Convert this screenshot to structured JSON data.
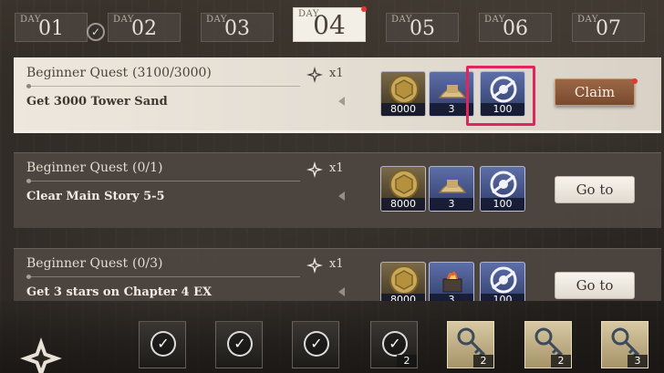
{
  "tabs": {
    "day_word": "DAY",
    "items": [
      {
        "num": "01",
        "completed": true
      },
      {
        "num": "02"
      },
      {
        "num": "03"
      },
      {
        "num": "04",
        "active": true,
        "notification": true
      },
      {
        "num": "05"
      },
      {
        "num": "06"
      },
      {
        "num": "07"
      }
    ]
  },
  "quests": [
    {
      "title": "Beginner Quest",
      "progress": "(3100/3000)",
      "multiplier": "x1",
      "description": "Get 3000 Tower Sand",
      "rewards": [
        "8000",
        "3",
        "100"
      ],
      "action": "Claim"
    },
    {
      "title": "Beginner Quest",
      "progress": "(0/1)",
      "multiplier": "x1",
      "description": "Clear Main Story 5-5",
      "rewards": [
        "8000",
        "3",
        "100"
      ],
      "action": "Go to"
    },
    {
      "title": "Beginner Quest",
      "progress": "(0/3)",
      "multiplier": "x1",
      "description": "Get 3 stars on Chapter 4 EX",
      "rewards": [
        "8000",
        "3",
        "100"
      ],
      "action": "Go to"
    }
  ],
  "bottom_track": {
    "slots": [
      {
        "type": "claimed",
        "count": ""
      },
      {
        "type": "claimed",
        "count": ""
      },
      {
        "type": "claimed",
        "count": ""
      },
      {
        "type": "claimed",
        "count": "2"
      },
      {
        "type": "key",
        "count": "2"
      },
      {
        "type": "key",
        "count": "2"
      },
      {
        "type": "key",
        "count": "3"
      }
    ]
  },
  "colors": {
    "accent_claim": "#8a5a3b",
    "highlight": "#e0245e",
    "active_tab": "#f3eee6"
  }
}
